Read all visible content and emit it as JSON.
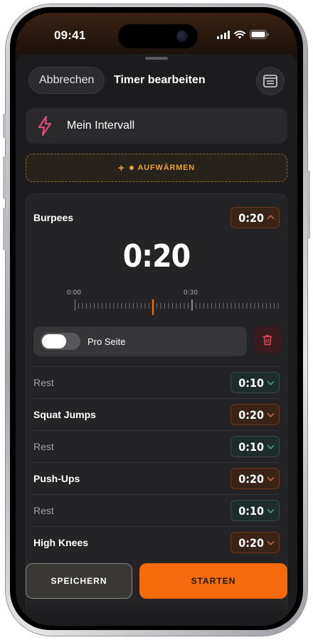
{
  "status_bar": {
    "time": "09:41"
  },
  "header": {
    "cancel_label": "Abbrechen",
    "title": "Timer bearbeiten",
    "notes_icon": "notes-icon"
  },
  "timer": {
    "name": "Mein Intervall",
    "icon": "bolt-icon"
  },
  "warmup": {
    "plus": "+",
    "label": "AUFWÄRMEN"
  },
  "current_exercise": {
    "name": "Burpees",
    "duration": "0:20",
    "display_time": "0:20",
    "ruler_labels": [
      "0:00",
      "0:30"
    ],
    "per_side_label": "Pro Seite",
    "per_side_on": false
  },
  "intervals": [
    {
      "label": "Rest",
      "duration": "0:10",
      "kind": "rest"
    },
    {
      "label": "Squat Jumps",
      "duration": "0:20",
      "kind": "work"
    },
    {
      "label": "Rest",
      "duration": "0:10",
      "kind": "rest"
    },
    {
      "label": "Push-Ups",
      "duration": "0:20",
      "kind": "work"
    },
    {
      "label": "Rest",
      "duration": "0:10",
      "kind": "rest"
    },
    {
      "label": "High Knees",
      "duration": "0:20",
      "kind": "work"
    }
  ],
  "footer": {
    "save_label": "SPEICHERN",
    "start_label": "STARTEN"
  },
  "colors": {
    "accent": "#f56a0a",
    "warmup": "#e8a23a",
    "rest_chevron": "#4fd1b0",
    "work_chevron": "#f5884a",
    "bolt": "#e8487a"
  }
}
